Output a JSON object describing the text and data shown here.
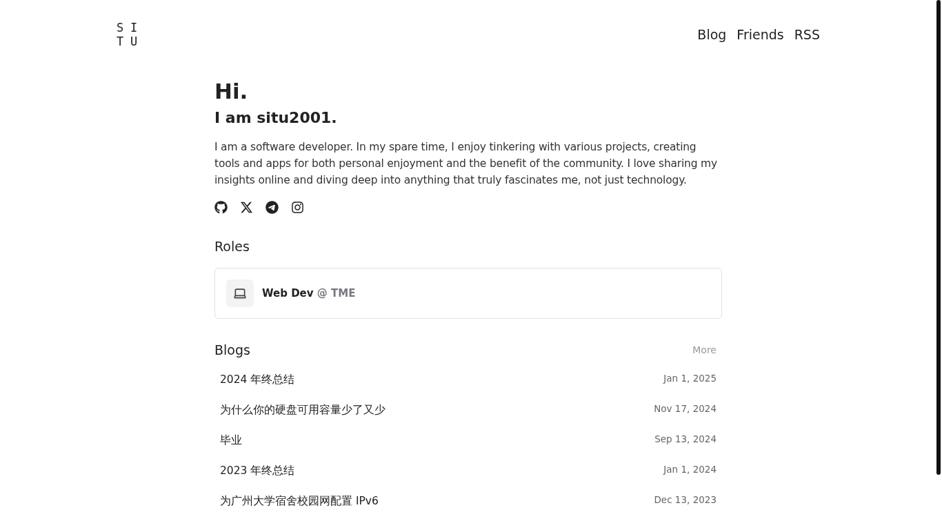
{
  "logo": {
    "letters": [
      "S",
      "I",
      "T",
      "U"
    ]
  },
  "nav": [
    {
      "label": "Blog"
    },
    {
      "label": "Friends"
    },
    {
      "label": "RSS"
    }
  ],
  "intro": {
    "greeting": "Hi.",
    "name_line": "I am situ2001.",
    "bio": "I am a software developer. In my spare time, I enjoy tinkering with various projects, creating tools and apps for both personal enjoyment and the benefit of the community. I love sharing my insights online and diving deep into anything that truly fascinates me, not just technology."
  },
  "social_links": [
    {
      "kind": "github"
    },
    {
      "kind": "x"
    },
    {
      "kind": "telegram"
    },
    {
      "kind": "instagram"
    }
  ],
  "roles": {
    "title": "Roles",
    "items": [
      {
        "role": "Web Dev",
        "org": "@ TME"
      }
    ]
  },
  "blogs": {
    "title": "Blogs",
    "more": "More",
    "posts": [
      {
        "title": "2024 年终总结",
        "date": "Jan 1, 2025"
      },
      {
        "title": "为什么你的硬盘可用容量少了又少",
        "date": "Nov 17, 2024"
      },
      {
        "title": "毕业",
        "date": "Sep 13, 2024"
      },
      {
        "title": "2023 年终总结",
        "date": "Jan 1, 2024"
      },
      {
        "title": "为广州大学宿舍校园网配置 IPv6",
        "date": "Dec 13, 2023"
      }
    ]
  }
}
